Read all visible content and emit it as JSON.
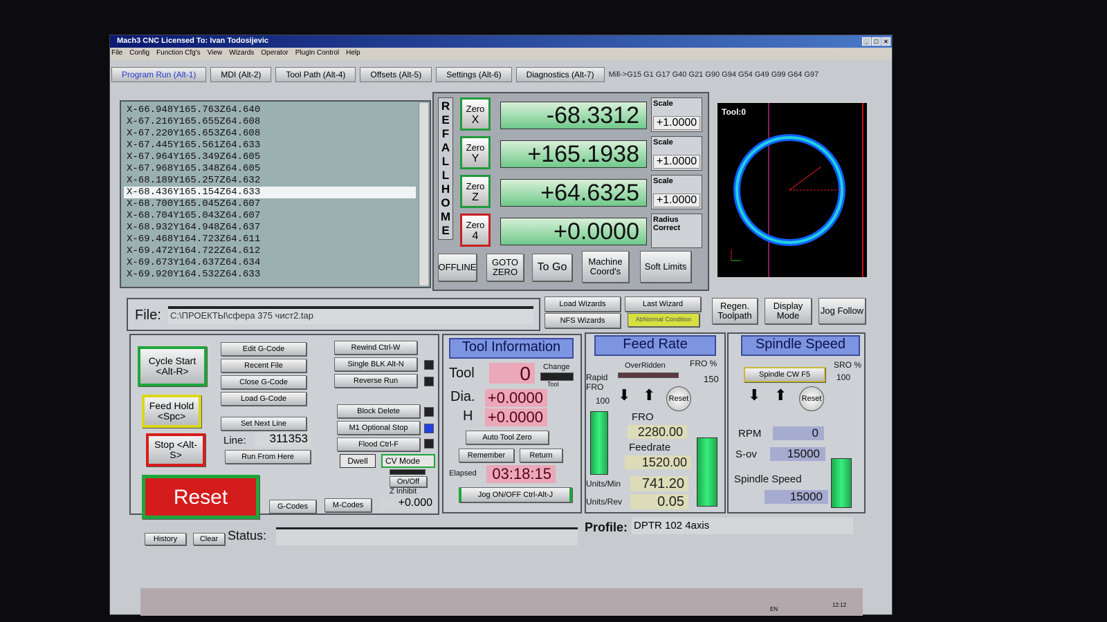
{
  "window": {
    "title": "Mach3 CNC  Licensed To: Ivan Todosijevic",
    "controls": [
      "_",
      "□",
      "×"
    ]
  },
  "menu": [
    "File",
    "Config",
    "Function Cfg's",
    "View",
    "Wizards",
    "Operator",
    "PlugIn Control",
    "Help"
  ],
  "tabs": [
    {
      "label": "Program Run (Alt-1)"
    },
    {
      "label": "MDI (Alt-2)"
    },
    {
      "label": "Tool Path (Alt-4)"
    },
    {
      "label": "Offsets (Alt-5)"
    },
    {
      "label": "Settings (Alt-6)"
    },
    {
      "label": "Diagnostics (Alt-7)"
    }
  ],
  "modal_codes": "Mill->G15  G1 G17 G40 G21 G90 G94 G54 G49 G99 G64 G97",
  "gcode_lines": [
    "X-66.948Y165.763Z64.640",
    "X-67.216Y165.655Z64.608",
    "X-67.220Y165.653Z64.608",
    "X-67.445Y165.561Z64.633",
    "X-67.964Y165.349Z64.605",
    "X-67.968Y165.348Z64.605",
    "X-68.189Y165.257Z64.632",
    "X-68.436Y165.154Z64.633",
    "X-68.700Y165.045Z64.607",
    "X-68.704Y165.043Z64.607",
    "X-68.932Y164.948Z64.637",
    "X-69.468Y164.723Z64.611",
    "X-69.472Y164.722Z64.612",
    "X-69.673Y164.637Z64.634",
    "X-69.920Y164.532Z64.633"
  ],
  "ref_all_home": [
    "R",
    "E",
    "F",
    "A",
    "L",
    "L",
    "H",
    "O",
    "M",
    "E"
  ],
  "axes": [
    {
      "zero": "Zero",
      "axis": "X",
      "value": "-68.3312",
      "scale_label": "Scale",
      "scale": "+1.0000"
    },
    {
      "zero": "Zero",
      "axis": "Y",
      "value": "+165.1938",
      "scale_label": "Scale",
      "scale": "+1.0000"
    },
    {
      "zero": "Zero",
      "axis": "Z",
      "value": "+64.6325",
      "scale_label": "Scale",
      "scale": "+1.0000"
    },
    {
      "zero": "Zero",
      "axis": "4",
      "value": "+0.0000",
      "scale_label": "Radius Correct",
      "scale": ""
    }
  ],
  "dro_buttons": [
    "OFFLINE",
    "GOTO ZERO",
    "To Go",
    "Machine Coord's",
    "Soft Limits"
  ],
  "toolpath": {
    "label": "Tool:0"
  },
  "file": {
    "label": "File:",
    "path": "C:\\ПРОЕКТЫ\\сфера 375 чист2.tap"
  },
  "wizards": {
    "load": "Load Wizards",
    "last": "Last Wizard",
    "nfs": "NFS Wizards",
    "abnormal": "AbNormal Condition"
  },
  "view_buttons": [
    "Regen. Toolpath",
    "Display Mode",
    "Jog Follow"
  ],
  "run": {
    "cycle_start": "Cycle Start <Alt-R>",
    "feed_hold": "Feed Hold <Spc>",
    "stop": "Stop <Alt-S>",
    "reset": "Reset"
  },
  "file_buttons": [
    "Edit G-Code",
    "Recent File",
    "Close G-Code",
    "Load G-Code",
    "Set Next Line",
    "Run From Here"
  ],
  "line": {
    "label": "Line:",
    "value": "311353"
  },
  "options": [
    "Rewind Ctrl-W",
    "Single BLK Alt-N",
    "Reverse Run",
    "Block Delete",
    "M1 Optional Stop",
    "Flood Ctrl-F"
  ],
  "dwell": "Dwell",
  "cv_mode": "CV Mode",
  "on_off": "On/Off",
  "z_inhibit": "Z Inhibit",
  "z_inhibit_value": "+0.000",
  "gcodes_btn": "G-Codes",
  "mcodes_btn": "M-Codes",
  "tool_info": {
    "title": "Tool Information",
    "tool_label": "Tool",
    "tool": "0",
    "change": "Change",
    "change_sub": "Tool",
    "dia_label": "Dia.",
    "dia": "+0.0000",
    "h_label": "H",
    "h": "+0.0000",
    "auto_zero": "Auto Tool Zero",
    "remember": "Remember",
    "return": "Return",
    "elapsed_label": "Elapsed",
    "elapsed": "03:18:15",
    "jog": "Jog ON/OFF Ctrl-Alt-J"
  },
  "feed": {
    "title": "Feed Rate",
    "overridden": "OverRidden",
    "fro_pct_label": "FRO %",
    "fro_pct": "150",
    "rapid_label": "Rapid FRO",
    "rapid": "100",
    "reset": "Reset",
    "fro_label": "FRO",
    "fro": "2280.00",
    "feedrate_label": "Feedrate",
    "feedrate": "1520.00",
    "upm_label": "Units/Min",
    "upm": "741.20",
    "upr_label": "Units/Rev",
    "upr": "0.05"
  },
  "spindle": {
    "title": "Spindle Speed",
    "cw": "Spindle CW F5",
    "sro_label": "SRO %",
    "sro": "100",
    "reset": "Reset",
    "rpm_label": "RPM",
    "rpm": "0",
    "sov_label": "S-ov",
    "sov": "15000",
    "speed_label": "Spindle Speed",
    "speed": "15000"
  },
  "status": {
    "history": "History",
    "clear": "Clear",
    "label": "Status:",
    "value": "",
    "profile_label": "Profile:",
    "profile": "DPTR 102 4axis"
  },
  "taskbar": {
    "lang": "EN",
    "time": "12:12"
  },
  "colors": {
    "dro": "#6fc98b",
    "accent": "#7d95e0",
    "reset": "#d81d1d"
  }
}
